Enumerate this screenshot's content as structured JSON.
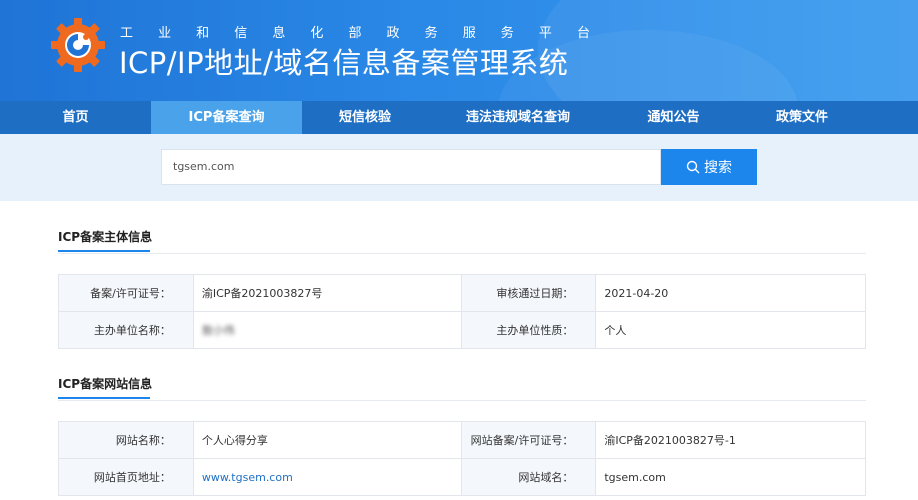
{
  "header": {
    "subtitle_chars": [
      "工",
      "业",
      "和",
      "信",
      "息",
      "化",
      "部",
      "政",
      "务",
      "服",
      "务",
      "平",
      "台"
    ],
    "title": "ICP/IP地址/域名信息备案管理系统"
  },
  "nav": {
    "items": [
      {
        "label": "首页",
        "active": false
      },
      {
        "label": "ICP备案查询",
        "active": true
      },
      {
        "label": "短信核验",
        "active": false
      },
      {
        "label": "违法违规域名查询",
        "active": false
      },
      {
        "label": "通知公告",
        "active": false
      },
      {
        "label": "政策文件",
        "active": false
      }
    ]
  },
  "search": {
    "value": "tgsem.com",
    "button_label": "搜索"
  },
  "subject_section": {
    "title": "ICP备案主体信息",
    "rows": [
      {
        "label1": "备案/许可证号：",
        "value1": "渝ICP备2021003827号",
        "label2": "审核通过日期：",
        "value2": "2021-04-20"
      },
      {
        "label1": "主办单位名称：",
        "value1": "敖小伟",
        "label2": "主办单位性质：",
        "value2": "个人"
      }
    ]
  },
  "website_section": {
    "title": "ICP备案网站信息",
    "rows": [
      {
        "label1": "网站名称：",
        "value1": "个人心得分享",
        "label2": "网站备案/许可证号：",
        "value2": "渝ICP备2021003827号-1"
      },
      {
        "label1": "网站首页地址：",
        "value1": "www.tgsem.com",
        "label2": "网站域名：",
        "value2": "tgsem.com"
      }
    ]
  },
  "colors": {
    "header_blue": "#1f74d6",
    "nav_blue": "#1e6fc4",
    "nav_active": "#4aa3ea",
    "search_button": "#1c86ec",
    "link": "#1e6fc4",
    "logo_orange": "#ef6a1f"
  }
}
